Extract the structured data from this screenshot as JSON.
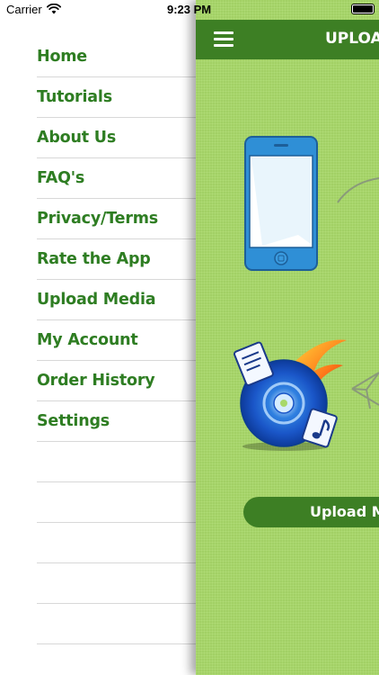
{
  "status_bar": {
    "carrier": "Carrier",
    "time": "9:23 PM"
  },
  "side_menu": {
    "items": [
      {
        "label": "Home"
      },
      {
        "label": "Tutorials"
      },
      {
        "label": "About Us"
      },
      {
        "label": "FAQ's"
      },
      {
        "label": "Privacy/Terms"
      },
      {
        "label": "Rate the App"
      },
      {
        "label": "Upload Media"
      },
      {
        "label": "My Account"
      },
      {
        "label": "Order History"
      },
      {
        "label": "Settings"
      }
    ]
  },
  "main": {
    "nav_title": "UPLOA",
    "upload_button_label": "Upload M",
    "icons": [
      "menu-icon",
      "phone-icon",
      "cd-music-icon",
      "paper-plane-icon"
    ]
  },
  "colors": {
    "brand_green": "#3d7f24",
    "menu_text": "#2e7d22",
    "background_green": "#a8d869",
    "phone_blue": "#2f8fd6"
  }
}
